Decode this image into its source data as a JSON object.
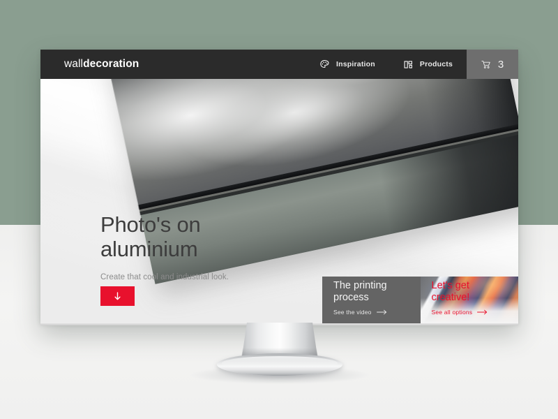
{
  "window": {
    "title": "walldecoration",
    "backdrop_top_color": "#8a9e90",
    "backdrop_floor_color": "#f0f0ef"
  },
  "header": {
    "logo": {
      "thin": "wall",
      "bold": "decoration"
    },
    "background_color": "#2b2b2b",
    "nav": [
      {
        "label": "Inspiration",
        "icon": "palette-icon"
      },
      {
        "label": "Products",
        "icon": "grid-layout-icon"
      }
    ],
    "cart": {
      "icon": "shopping-cart-icon",
      "count": "3",
      "background_color": "#6e6e6e"
    }
  },
  "hero": {
    "title": "Photo's on\naluminium",
    "subtitle": "Create that cool and industrial look.",
    "cta": {
      "icon": "arrow-down-icon",
      "color": "#e8112d"
    },
    "image_alt": "Tilted aluminium print of a seascape with dark storm clouds over water"
  },
  "cards": [
    {
      "title": "The printing\nprocess",
      "link": "See the video",
      "link_icon": "arrow-right-icon",
      "background_color": "#646464",
      "text_color": "#f4f4f4"
    },
    {
      "title": "Let's get\ncreative!",
      "link": "See all options",
      "link_icon": "arrow-right-icon",
      "background_color": "#d9d9d9",
      "text_color": "#e8112d",
      "image_alt": "Colourful photo prints laid out on a grey surface"
    }
  ]
}
